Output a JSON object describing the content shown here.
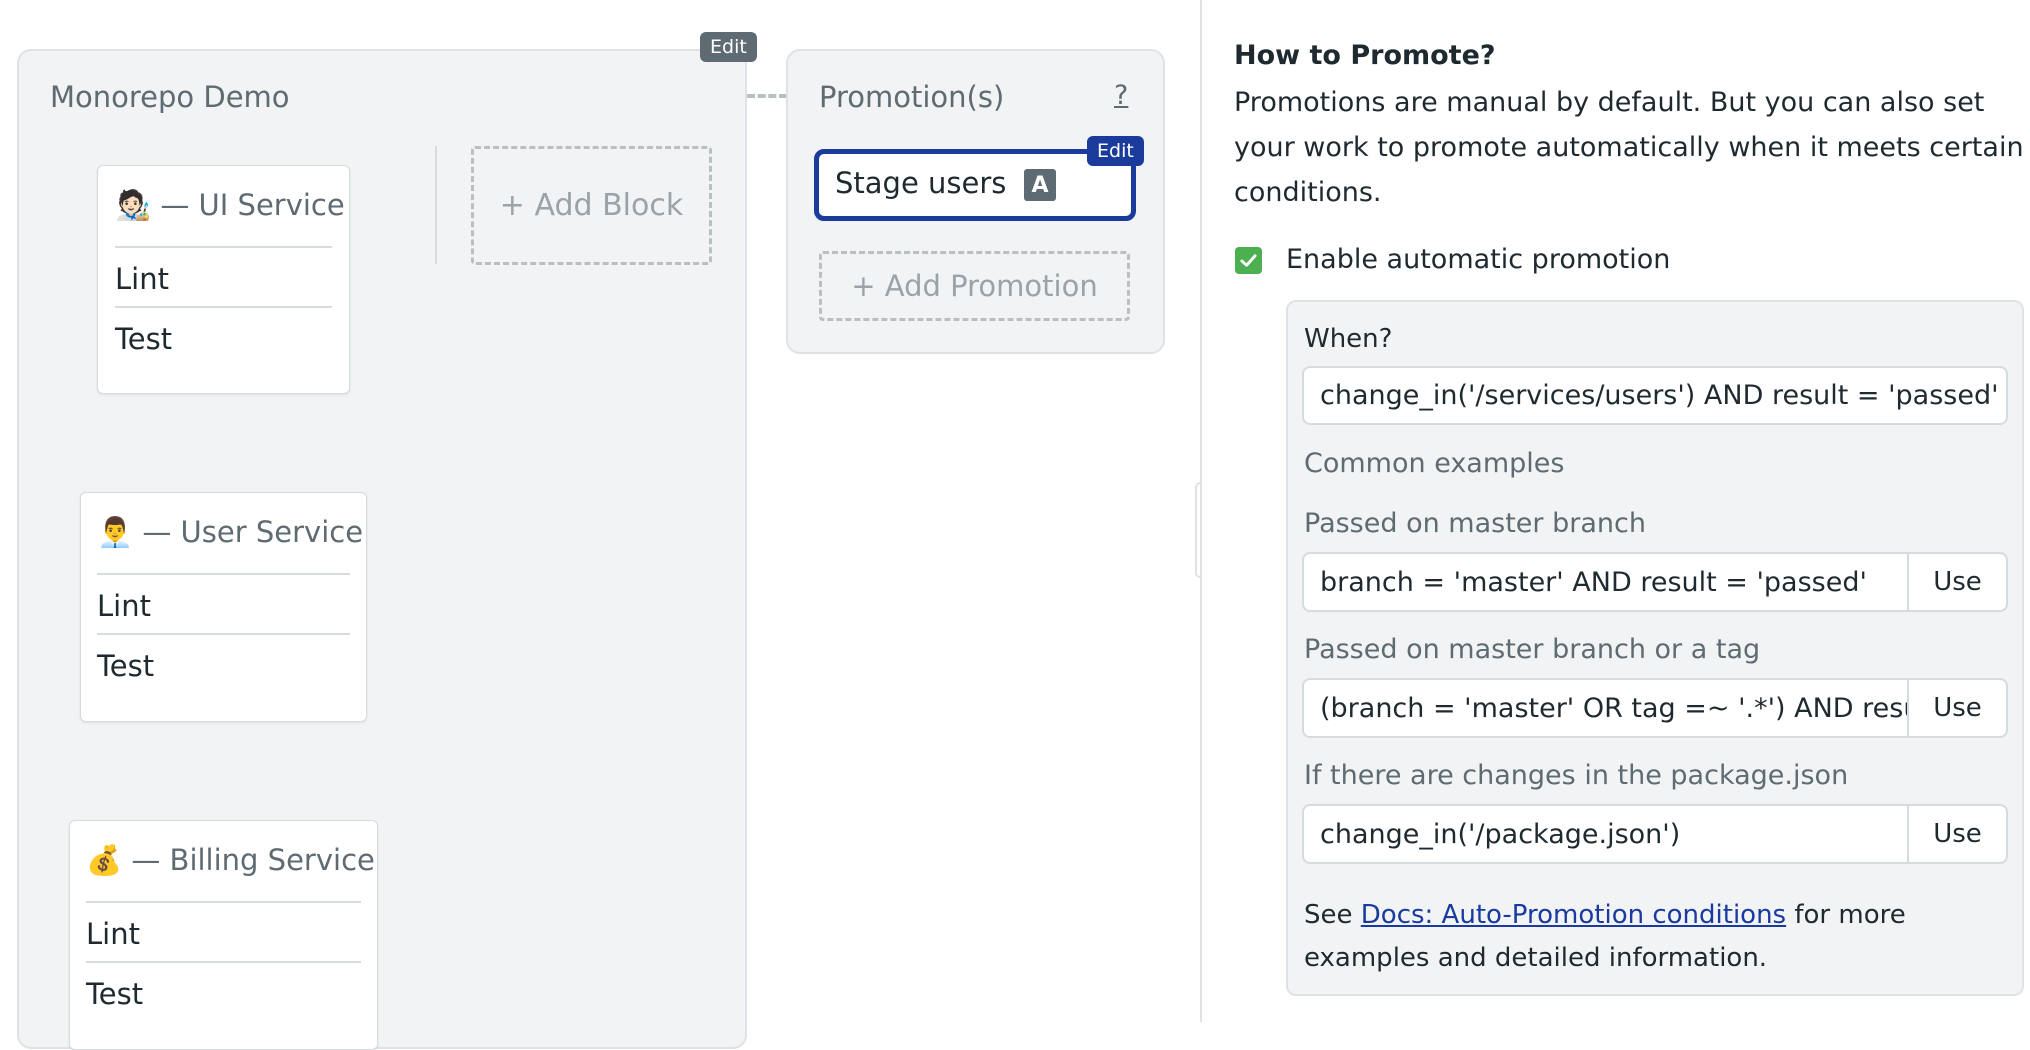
{
  "pipeline": {
    "title": "Monorepo Demo",
    "edit_label": "Edit",
    "add_block_label": "+ Add Block",
    "blocks": [
      {
        "name": "— UI Service",
        "icon": "🧑🏻‍🎨",
        "jobs": [
          "Lint",
          "Test"
        ]
      },
      {
        "name": "— User Service",
        "icon": "👨‍💼",
        "jobs": [
          "Lint",
          "Test"
        ]
      },
      {
        "name": "— Billing Service",
        "icon": "💰",
        "jobs": [
          "Lint",
          "Test"
        ]
      }
    ]
  },
  "promotions": {
    "title": "Promotion(s)",
    "help": "?",
    "card_label": "Stage users",
    "card_badge": "A",
    "edit_label": "Edit",
    "add_label": "+ Add Promotion"
  },
  "sidebar": {
    "heading": "How to Promote?",
    "description": "Promotions are manual by default. But you can also set your work to promote automatically when it meets certain conditions.",
    "checkbox_label": "Enable automatic promotion",
    "checkbox_checked": true,
    "when_label": "When?",
    "when_value": "change_in('/services/users') AND result = 'passed'",
    "examples_title": "Common examples",
    "examples": [
      {
        "label": "Passed on master branch",
        "value": "branch = 'master' AND result = 'passed'",
        "button": "Use"
      },
      {
        "label": "Passed on master branch or a tag",
        "value": "(branch = 'master' OR tag =~ '.*') AND result",
        "button": "Use"
      },
      {
        "label": "If there are changes in the package.json",
        "value": "change_in('/package.json')",
        "button": "Use"
      }
    ],
    "docs_prefix": "See ",
    "docs_link": "Docs: Auto-Promotion conditions",
    "docs_suffix": " for more examples and detailed information."
  },
  "colors": {
    "accent": "#1a3a9c",
    "check_green": "#4caf50",
    "panel_bg": "#f1f3f4",
    "muted_text": "#5f6b72"
  }
}
